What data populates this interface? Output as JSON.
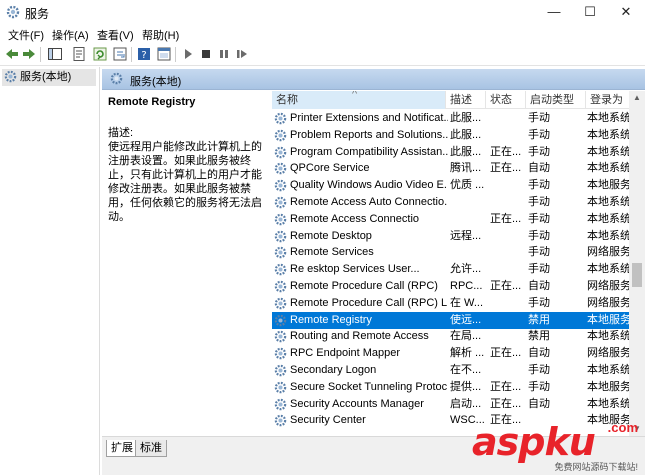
{
  "window": {
    "title": "服务",
    "minimize": "—",
    "maximize": "☐",
    "close": "✕"
  },
  "menu": [
    "文件(F)",
    "操作(A)",
    "查看(V)",
    "帮助(H)"
  ],
  "tree": {
    "item": "服务(本地)"
  },
  "pane_header": "服务(本地)",
  "description": {
    "service_name": "Remote Registry",
    "label": "描述:",
    "text": "使远程用户能修改此计算机上的注册表设置。如果此服务被终止，只有此计算机上的用户才能修改注册表。如果此服务被禁用，任何依赖它的服务将无法启动。"
  },
  "columns": {
    "name": "名称",
    "desc": "描述",
    "state": "状态",
    "startup": "启动类型",
    "logon": "登录为"
  },
  "rows": [
    {
      "name": "Printer Extensions and Notificat...",
      "desc": "此服...",
      "state": "",
      "startup": "手动",
      "logon": "本地系统"
    },
    {
      "name": "Problem Reports and Solutions...",
      "desc": "此服...",
      "state": "",
      "startup": "手动",
      "logon": "本地系统"
    },
    {
      "name": "Program Compatibility Assistan...",
      "desc": "此服...",
      "state": "正在...",
      "startup": "手动",
      "logon": "本地系统"
    },
    {
      "name": "QPCore Service",
      "desc": "腾讯...",
      "state": "正在...",
      "startup": "自动",
      "logon": "本地系统"
    },
    {
      "name": "Quality Windows Audio Video E...",
      "desc": "优质 ...",
      "state": "",
      "startup": "手动",
      "logon": "本地服务"
    },
    {
      "name": "Remote Access Auto Connectio...",
      "desc": "",
      "state": "",
      "startup": "手动",
      "logon": "本地系统"
    },
    {
      "name": "Remote Access Connectio",
      "desc": "",
      "state": "正在...",
      "startup": "手动",
      "logon": "本地系统"
    },
    {
      "name": "Remote Desktop",
      "desc": "远程...",
      "state": "",
      "startup": "手动",
      "logon": "本地系统"
    },
    {
      "name": "Remote   Services",
      "desc": "",
      "state": "",
      "startup": "手动",
      "logon": "网络服务"
    },
    {
      "name": "Re     esktop Services User...",
      "desc": "允许...",
      "state": "",
      "startup": "手动",
      "logon": "本地系统"
    },
    {
      "name": "Remote Procedure Call (RPC)",
      "desc": "RPC...",
      "state": "正在...",
      "startup": "自动",
      "logon": "网络服务"
    },
    {
      "name": "Remote Procedure Call (RPC) L...",
      "desc": "在 W...",
      "state": "",
      "startup": "手动",
      "logon": "网络服务"
    },
    {
      "name": "Remote Registry",
      "desc": "使远...",
      "state": "",
      "startup": "禁用",
      "logon": "本地服务",
      "selected": true
    },
    {
      "name": "Routing and Remote Access",
      "desc": "在局...",
      "state": "",
      "startup": "禁用",
      "logon": "本地系统"
    },
    {
      "name": "RPC Endpoint Mapper",
      "desc": "解析 ...",
      "state": "正在...",
      "startup": "自动",
      "logon": "网络服务"
    },
    {
      "name": "Secondary Logon",
      "desc": "在不...",
      "state": "",
      "startup": "手动",
      "logon": "本地系统"
    },
    {
      "name": "Secure Socket Tunneling Protoc...",
      "desc": "提供...",
      "state": "正在...",
      "startup": "手动",
      "logon": "本地服务"
    },
    {
      "name": "Security Accounts Manager",
      "desc": "启动...",
      "state": "正在...",
      "startup": "自动",
      "logon": "本地系统"
    },
    {
      "name": "Security Center",
      "desc": "WSC...",
      "state": "正在...",
      "startup": "",
      "logon": "本地服务"
    }
  ],
  "tabs": [
    "扩展",
    "标准"
  ],
  "watermark": {
    "brand": "aspku",
    "domain": ".com",
    "slogan": "免费网站源码下载站!"
  },
  "colors": {
    "selection": "#0078d7",
    "header_gradient_top": "#c6d9ef",
    "watermark": "#e8232a"
  }
}
